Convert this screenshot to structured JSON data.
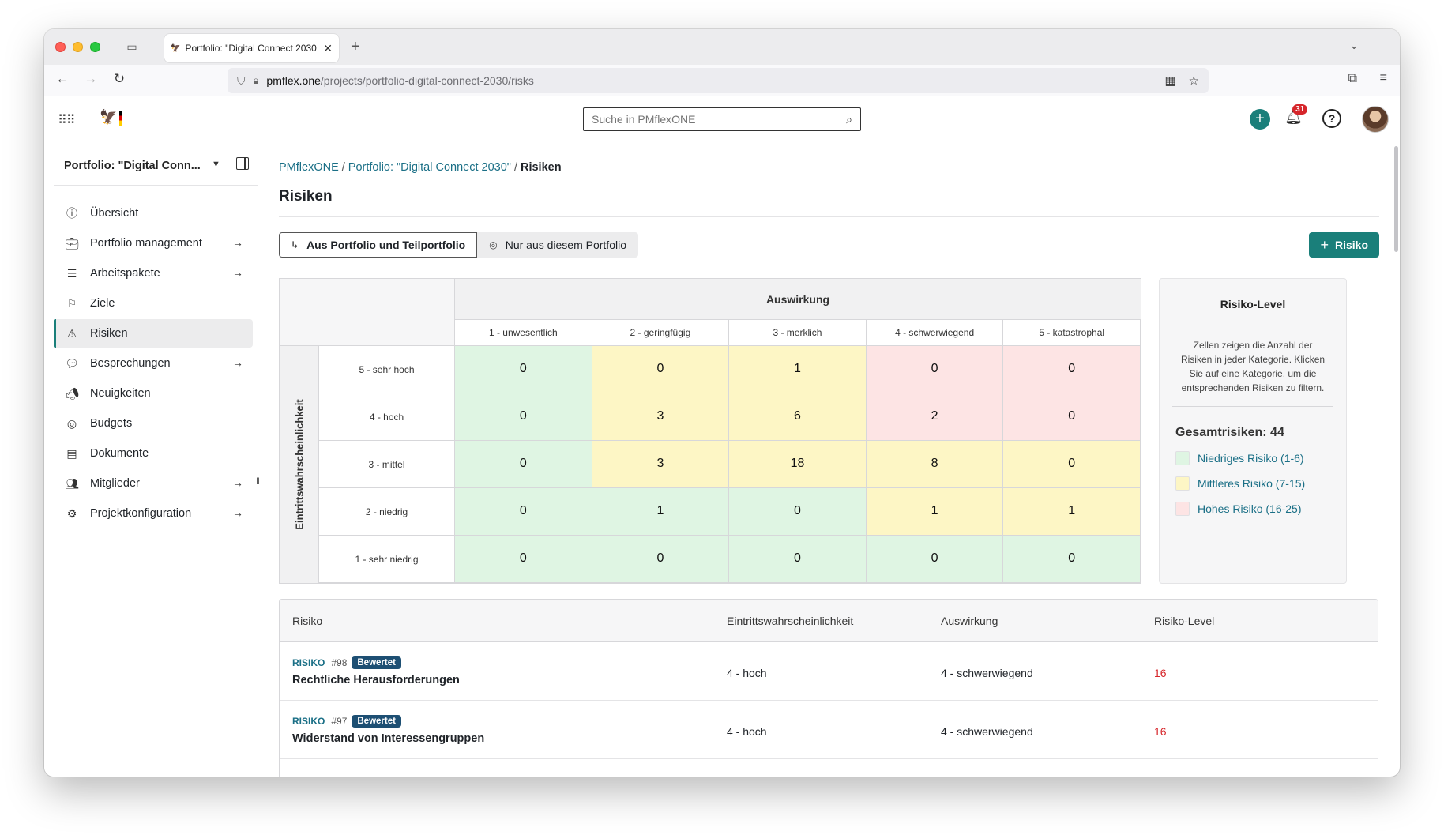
{
  "browser": {
    "tab_title": "Portfolio: \"Digital Connect 2030",
    "url_host": "pmflex.one",
    "url_path": "/projects/portfolio-digital-connect-2030/risks"
  },
  "header": {
    "search_placeholder": "Suche in PMflexONE",
    "notification_count": "31"
  },
  "sidebar": {
    "project_name": "Portfolio: \"Digital Conn...",
    "items": [
      {
        "label": "Übersicht",
        "icon": "info-icon",
        "arrow": false
      },
      {
        "label": "Portfolio management",
        "icon": "briefcase-icon",
        "arrow": true
      },
      {
        "label": "Arbeitspakete",
        "icon": "list-icon",
        "arrow": true
      },
      {
        "label": "Ziele",
        "icon": "goal-icon",
        "arrow": false
      },
      {
        "label": "Risiken",
        "icon": "warning-icon",
        "arrow": false,
        "active": true
      },
      {
        "label": "Besprechungen",
        "icon": "chat-icon",
        "arrow": true
      },
      {
        "label": "Neuigkeiten",
        "icon": "megaphone-icon",
        "arrow": false
      },
      {
        "label": "Budgets",
        "icon": "coins-icon",
        "arrow": false
      },
      {
        "label": "Dokumente",
        "icon": "document-icon",
        "arrow": false
      },
      {
        "label": "Mitglieder",
        "icon": "members-icon",
        "arrow": true
      },
      {
        "label": "Projektkonfiguration",
        "icon": "gear-icon",
        "arrow": true
      }
    ]
  },
  "breadcrumb": {
    "root": "PMflexONE",
    "parent": "Portfolio: \"Digital Connect 2030\"",
    "current": "Risiken"
  },
  "page": {
    "title": "Risiken",
    "scope_all": "Aus Portfolio und Teilportfolio",
    "scope_this": "Nur aus diesem Portfolio",
    "add_button": "Risiko"
  },
  "matrix": {
    "impact_title": "Auswirkung",
    "probability_title": "Eintrittswahrscheinlichkeit",
    "impact_levels": [
      "1 - unwesentlich",
      "2 - geringfügig",
      "3 - merklich",
      "4 - schwerwiegend",
      "5 - katastrophal"
    ],
    "probability_levels": [
      "5 - sehr hoch",
      "4 - hoch",
      "3 - mittel",
      "2 - niedrig",
      "1 - sehr niedrig"
    ],
    "counts": [
      [
        0,
        0,
        1,
        0,
        0
      ],
      [
        0,
        3,
        6,
        2,
        0
      ],
      [
        0,
        3,
        18,
        8,
        0
      ],
      [
        0,
        1,
        0,
        1,
        1
      ],
      [
        0,
        0,
        0,
        0,
        0
      ]
    ],
    "levels": [
      [
        "low",
        "mid",
        "mid",
        "high",
        "high"
      ],
      [
        "low",
        "mid",
        "mid",
        "high",
        "high"
      ],
      [
        "low",
        "mid",
        "mid",
        "mid",
        "mid"
      ],
      [
        "low",
        "low",
        "low",
        "mid",
        "mid"
      ],
      [
        "low",
        "low",
        "low",
        "low",
        "low"
      ]
    ]
  },
  "legend": {
    "title": "Risiko-Level",
    "description": "Zellen zeigen die Anzahl der Risiken in jeder Kategorie. Klicken Sie auf eine Kategorie, um die entsprechenden Risiken zu filtern.",
    "total": "Gesamtrisiken: 44",
    "low": "Niedriges Risiko (1-6)",
    "mid": "Mittleres Risiko (7-15)",
    "high": "Hohes Risiko (16-25)",
    "colors": {
      "low": "#dff5e3",
      "mid": "#fdf6c5",
      "high": "#fde4e4"
    }
  },
  "table": {
    "headers": [
      "Risiko",
      "Eintrittswahrscheinlichkeit",
      "Auswirkung",
      "Risiko-Level"
    ],
    "rows": [
      {
        "kind": "RISIKO",
        "number": "#98",
        "status": "Bewertet",
        "name": "Rechtliche Herausforderungen",
        "probability": "4 - hoch",
        "impact": "4 - schwerwiegend",
        "level": "16"
      },
      {
        "kind": "RISIKO",
        "number": "#97",
        "status": "Bewertet",
        "name": "Widerstand von Interessengruppen",
        "probability": "4 - hoch",
        "impact": "4 - schwerwiegend",
        "level": "16"
      }
    ]
  },
  "colors": {
    "accent": "#1a7f7a",
    "link": "#1a6f86",
    "danger": "#d6262b",
    "badge": "#1d4f73"
  }
}
